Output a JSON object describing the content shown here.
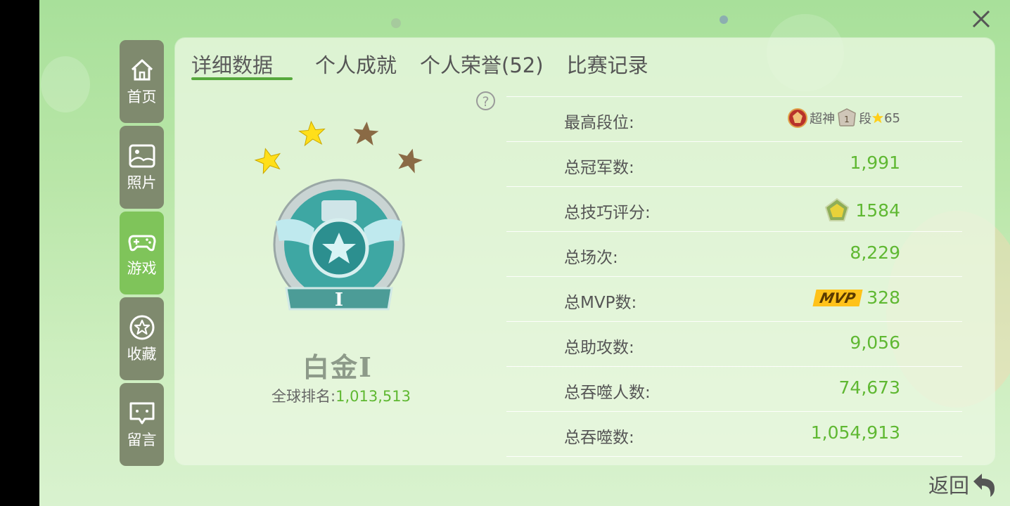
{
  "tabs": [
    {
      "label": "详细数据"
    },
    {
      "label": "个人成就"
    },
    {
      "label": "个人荣誉(52)"
    },
    {
      "label": "比赛记录"
    }
  ],
  "sidebar": {
    "items": [
      {
        "label": "首页",
        "icon": "home-icon"
      },
      {
        "label": "照片",
        "icon": "photo-icon"
      },
      {
        "label": "游戏",
        "icon": "gamepad-icon"
      },
      {
        "label": "收藏",
        "icon": "star-icon"
      },
      {
        "label": "留言",
        "icon": "message-icon"
      }
    ],
    "active_index": 2
  },
  "rank": {
    "name": "白金Ⅰ",
    "global_label": "全球排名:",
    "global_value": "1,013,513",
    "badge_numeral": "I",
    "stars_total": 4,
    "stars_filled": 2
  },
  "peak": {
    "label": "最高段位:",
    "tier": "超神",
    "level": "1",
    "suffix": "段",
    "stars": "65"
  },
  "stats": [
    {
      "label": "总冠军数:",
      "value": "1,991"
    },
    {
      "label": "总技巧评分:",
      "value": "1584",
      "icon": "pentagon-icon"
    },
    {
      "label": "总场次:",
      "value": "8,229"
    },
    {
      "label": "总MVP数:",
      "value": "328",
      "badge": "MVP"
    },
    {
      "label": "总助攻数:",
      "value": "9,056"
    },
    {
      "label": "总吞噬人数:",
      "value": "74,673"
    },
    {
      "label": "总吞噬数:",
      "value": "1,054,913"
    }
  ],
  "back_label": "返回",
  "colors": {
    "accent_green": "#5fb832",
    "tab_underline": "#56a83c",
    "sidebar_bg": "#7f8a6e",
    "sidebar_active": "#7fc45a",
    "mvp_yellow": "#ffc21a"
  }
}
